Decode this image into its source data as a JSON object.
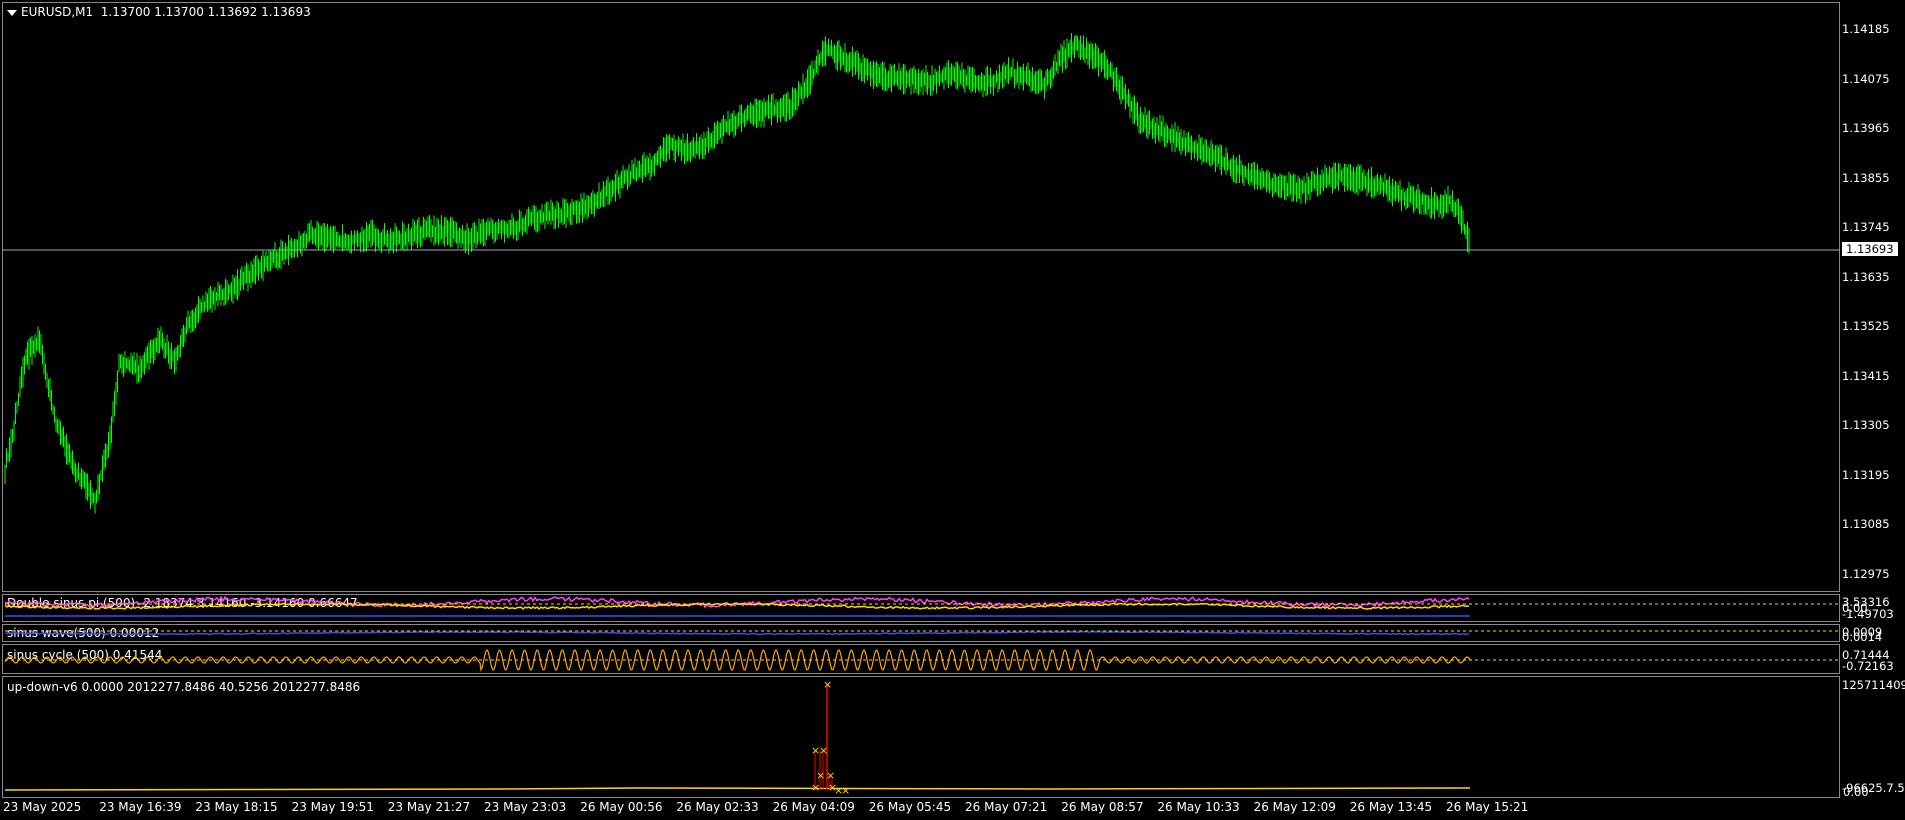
{
  "main_chart": {
    "title": "EURUSD,M1  1.13700 1.13700 1.13692 1.13693",
    "price_labels": [
      "1.14185",
      "1.14075",
      "1.13965",
      "1.13855",
      "1.13745",
      "1.13635",
      "1.13525",
      "1.13415",
      "1.13305",
      "1.13195",
      "1.13085",
      "1.12975"
    ],
    "current_price": "1.13693",
    "colors": {
      "candles": "#00ff00",
      "current_line": "#a0a8b8"
    },
    "open_candles": [
      "1.13700",
      "1.13700",
      "1.13692",
      "1.13693"
    ]
  },
  "indicators": [
    {
      "title": "Double sinus pi (500) -2.18374 3.14160 -3.14160 0.66647",
      "scale": [
        "3.53316",
        "0.00",
        "-1.49703"
      ],
      "colors": [
        "#ff40ff",
        "#ffd700",
        "#3050ff"
      ]
    },
    {
      "title": "sinus wave(500) 0.00012",
      "scale": [
        "0.0009",
        "0.0014"
      ],
      "colors": [
        "#3050ff"
      ]
    },
    {
      "title": "sinus cycle (500) 0.41544",
      "scale": [
        "0.71444",
        "-0.72163"
      ],
      "colors": [
        "#ffa500"
      ]
    },
    {
      "title": "up-down-v6 0.0000 2012277.8486 40.5256 2012277.8486",
      "scale": [
        "125711409",
        "-96625.7.5",
        "0.00"
      ],
      "colors": [
        "#ffd700",
        "#ff0000"
      ]
    }
  ],
  "time_axis": [
    "23 May 2025",
    "23 May 16:39",
    "23 May 18:15",
    "23 May 19:51",
    "23 May 21:27",
    "23 May 23:03",
    "26 May 00:56",
    "26 May 02:33",
    "26 May 04:09",
    "26 May 05:45",
    "26 May 07:21",
    "26 May 08:57",
    "26 May 10:33",
    "26 May 12:09",
    "26 May 13:45",
    "26 May 15:21"
  ]
}
